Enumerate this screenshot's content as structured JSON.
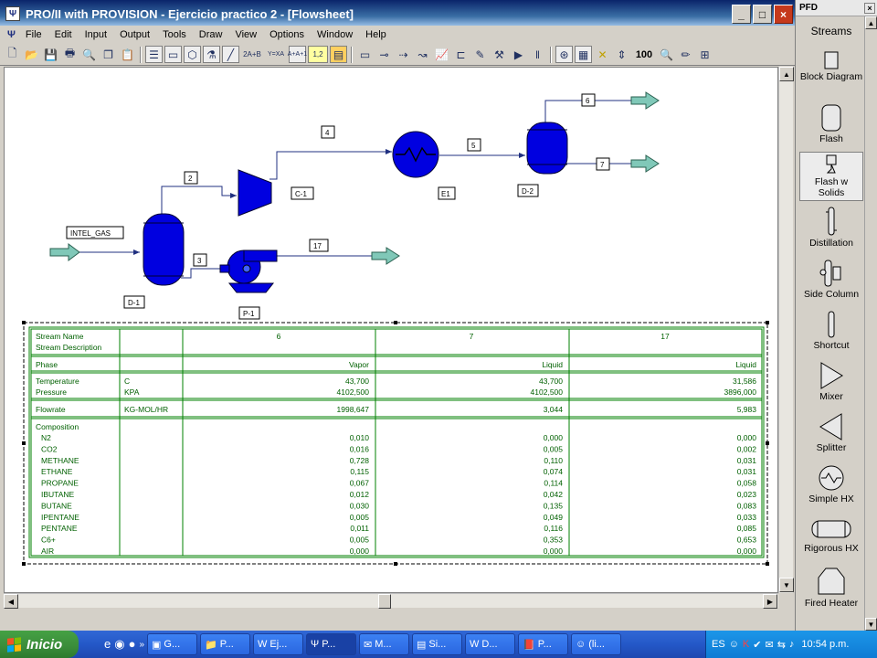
{
  "window": {
    "title": "PRO/II with PROVISION - Ejercicio practico 2 - [Flowsheet]",
    "controls": [
      "_",
      "□",
      "×"
    ]
  },
  "menu": [
    "File",
    "Edit",
    "Input",
    "Output",
    "Tools",
    "Draw",
    "View",
    "Options",
    "Window",
    "Help"
  ],
  "toolbar_text": {
    "n12": "1,2",
    "eq": "2A+B",
    "yx": "Y=XA",
    "ab": "A+A+1",
    "zoom": "100"
  },
  "flowsheet": {
    "units": [
      "D-1",
      "C-1",
      "E1",
      "D-2",
      "P-1"
    ],
    "streams": [
      "INTEL_GAS",
      "2",
      "3",
      "4",
      "5",
      "6",
      "7",
      "17"
    ]
  },
  "stream_table": {
    "headers": {
      "name": "Stream Name",
      "desc": "Stream Description",
      "phase": "Phase",
      "temperature": "Temperature",
      "pressure": "Pressure",
      "flowrate": "Flowrate",
      "composition": "Composition"
    },
    "units": {
      "temperature": "C",
      "pressure": "KPA",
      "flowrate": "KG-MOL/HR"
    },
    "columns": [
      {
        "name": "6",
        "phase": "Vapor",
        "temperature": "43,700",
        "pressure": "4102,500",
        "flowrate": "1998,647",
        "comp": [
          "0,010",
          "0,016",
          "0,728",
          "0,115",
          "0,067",
          "0,012",
          "0,030",
          "0,005",
          "0,011",
          "0,005",
          "0,000"
        ]
      },
      {
        "name": "7",
        "phase": "Liquid",
        "temperature": "43,700",
        "pressure": "4102,500",
        "flowrate": "3,044",
        "comp": [
          "0,000",
          "0,005",
          "0,110",
          "0,074",
          "0,114",
          "0,042",
          "0,135",
          "0,049",
          "0,116",
          "0,353",
          "0,000"
        ]
      },
      {
        "name": "17",
        "phase": "Liquid",
        "temperature": "31,586",
        "pressure": "3896,000",
        "flowrate": "5,983",
        "comp": [
          "0,000",
          "0,002",
          "0,031",
          "0,031",
          "0,058",
          "0,023",
          "0,083",
          "0,033",
          "0,085",
          "0,653",
          "0,000"
        ]
      }
    ],
    "components": [
      "N2",
      "CO2",
      "METHANE",
      "ETHANE",
      "PROPANE",
      "IBUTANE",
      "BUTANE",
      "IPENTANE",
      "PENTANE",
      "C6+",
      "AIR"
    ]
  },
  "pfd_palette": {
    "title": "PFD",
    "items": [
      "Streams",
      "Block Diagram",
      "Flash",
      "Flash w Solids",
      "Distillation",
      "Side Column",
      "Shortcut",
      "Mixer",
      "Splitter",
      "Simple HX",
      "Rigorous HX",
      "Fired Heater"
    ]
  },
  "taskbar": {
    "start": "Inicio",
    "tasks": [
      "G...",
      "P...",
      "Ej...",
      "P...",
      "M...",
      "Si...",
      "D...",
      "P...",
      "(li..."
    ],
    "lang": "ES",
    "clock": "10:54 p.m."
  },
  "colors": {
    "unit_fill": "#0000e0",
    "stream_line": "#203080",
    "table_text": "#006000",
    "table_border": "#008000",
    "arrow_fill": "#80c8b8"
  }
}
